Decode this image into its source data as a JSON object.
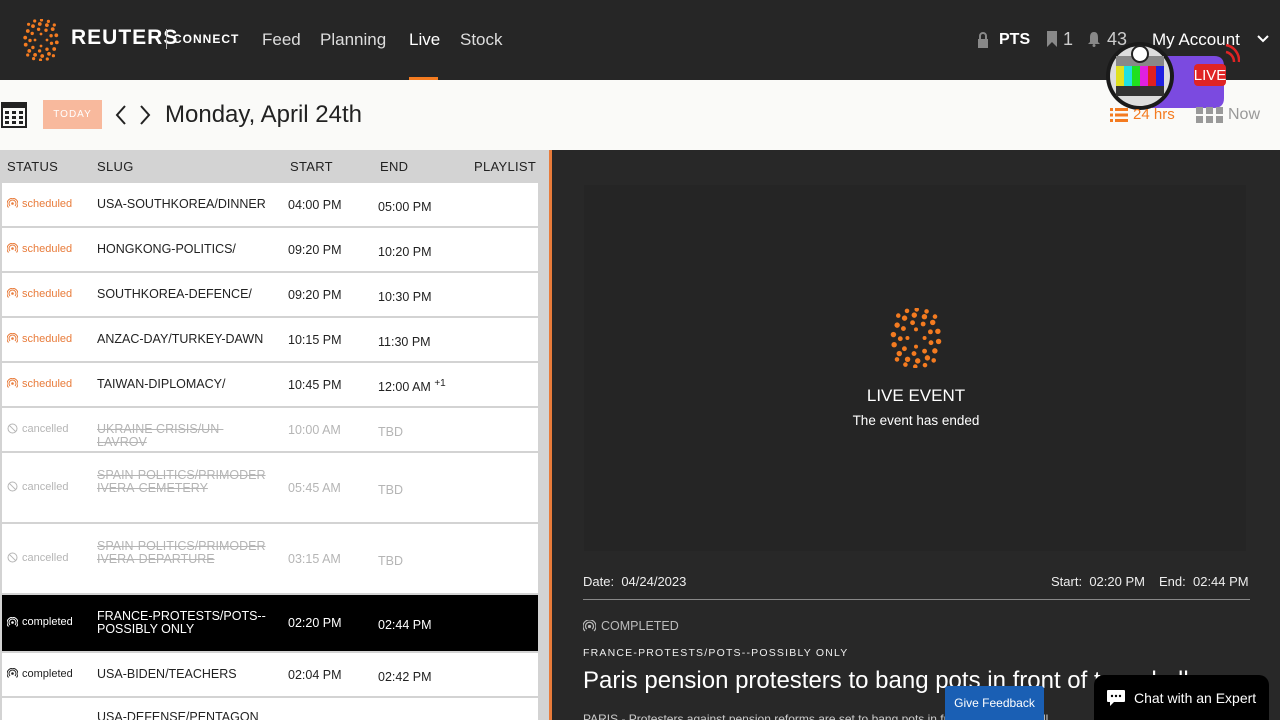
{
  "brand": {
    "name": "REUTERS",
    "product": "CONNECT"
  },
  "nav": [
    "Feed",
    "Planning",
    "Live",
    "Stock"
  ],
  "top_right": {
    "pts": "PTS",
    "bookmarks": "1",
    "notifications": "43",
    "account": "My Account"
  },
  "live_badge": "LIVE",
  "date_bar": {
    "today": "TODAY",
    "date": "Monday, April 24th",
    "hrs": "24 hrs",
    "now": "Now"
  },
  "table": {
    "headers": [
      "STATUS",
      "SLUG",
      "START",
      "END",
      "PLAYLIST"
    ],
    "rows": [
      {
        "status": "scheduled",
        "slug": "USA-SOUTHKOREA/DINNER",
        "start": "04:00 PM",
        "end": "05:00 PM",
        "sup": ""
      },
      {
        "status": "scheduled",
        "slug": "HONGKONG-POLITICS/",
        "start": "09:20 PM",
        "end": "10:20 PM",
        "sup": ""
      },
      {
        "status": "scheduled",
        "slug": "SOUTHKOREA-DEFENCE/",
        "start": "09:20 PM",
        "end": "10:30 PM",
        "sup": ""
      },
      {
        "status": "scheduled",
        "slug": "ANZAC-DAY/TURKEY-DAWN",
        "start": "10:15 PM",
        "end": "11:30 PM",
        "sup": ""
      },
      {
        "status": "scheduled",
        "slug": "TAIWAN-DIPLOMACY/",
        "start": "10:45 PM",
        "end": "12:00 AM",
        "sup": "+1"
      },
      {
        "status": "cancelled",
        "slug": "UKRAINE CRISIS/UN-LAVROV",
        "start": "10:00 AM",
        "end": "TBD",
        "sup": ""
      },
      {
        "status": "cancelled",
        "slug": "SPAIN-POLITICS/PRIMODERIVERA-CEMETERY",
        "start": "05:45 AM",
        "end": "TBD",
        "sup": ""
      },
      {
        "status": "cancelled",
        "slug": "SPAIN-POLITICS/PRIMODERIVERA-DEPARTURE",
        "start": "03:15 AM",
        "end": "TBD",
        "sup": ""
      },
      {
        "status": "completed",
        "slug": "FRANCE-PROTESTS/POTS--POSSIBLY ONLY",
        "start": "02:20 PM",
        "end": "02:44 PM",
        "sup": ""
      },
      {
        "status": "completed",
        "slug": "USA-BIDEN/TEACHERS",
        "start": "02:04 PM",
        "end": "02:42 PM",
        "sup": ""
      },
      {
        "status": "",
        "slug": "USA-DEFENSE/PENTAGON",
        "start": "",
        "end": "",
        "sup": ""
      }
    ]
  },
  "detail": {
    "event_title": "LIVE EVENT",
    "event_sub": "The event has ended",
    "date_label": "Date:",
    "date": "04/24/2023",
    "start_label": "Start:",
    "start": "02:20 PM",
    "end_label": "End:",
    "end": "02:44 PM",
    "status": "COMPLETED",
    "slug": "FRANCE-PROTESTS/POTS--POSSIBLY ONLY",
    "headline": "Paris pension protesters to bang pots in front of town hall",
    "body": "PARIS - Protesters against pension reforms are set to bang pots in front of the town hall"
  },
  "feedback": "Give Feedback",
  "chat": "Chat with an Expert",
  "colors": {
    "accent": "#f47b20",
    "topbar": "#262626",
    "panel": "#282828"
  }
}
